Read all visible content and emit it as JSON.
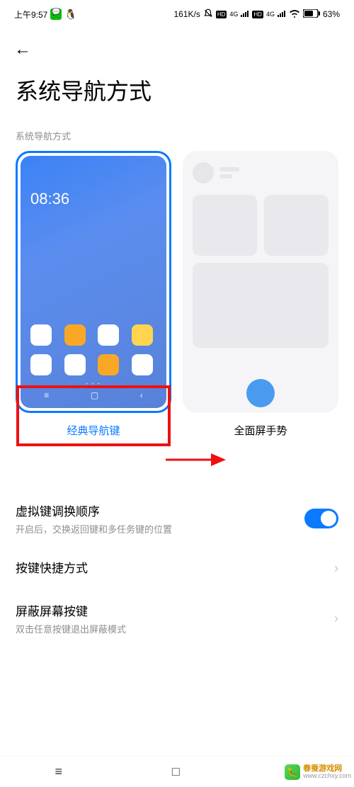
{
  "status_bar": {
    "time": "上午9:57",
    "speed": "161K/s",
    "net_label_4g": "4G",
    "hd_label": "HD",
    "battery_pct": "63%"
  },
  "header": {
    "back_icon": "←"
  },
  "page": {
    "title": "系统导航方式",
    "section_label": "系统导航方式"
  },
  "options": {
    "classic": {
      "label": "经典导航键",
      "preview_time": "08:36",
      "selected": true
    },
    "gestures": {
      "label": "全面屏手势",
      "selected": false
    }
  },
  "settings": {
    "swap_keys": {
      "title": "虚拟键调换顺序",
      "desc": "开启后，交换返回键和多任务键的位置",
      "enabled": true
    },
    "shortcut": {
      "title": "按键快捷方式"
    },
    "shield": {
      "title": "屏蔽屏幕按键",
      "desc": "双击任意按键退出屏蔽模式"
    }
  },
  "sys_nav": {
    "menu": "≡",
    "home": "□",
    "back": "◁"
  },
  "watermark": {
    "name": "春蚕游戏网",
    "url": "www.czchxy.com"
  }
}
